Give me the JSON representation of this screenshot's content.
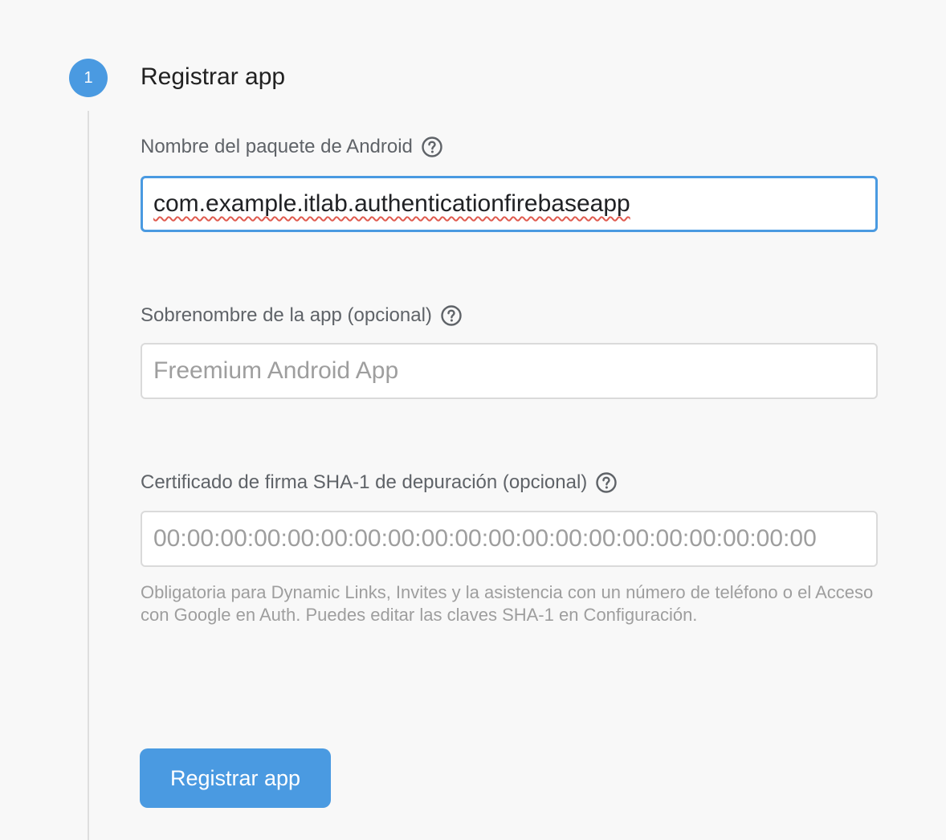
{
  "step": {
    "number": "1",
    "title": "Registrar app"
  },
  "package_field": {
    "label": "Nombre del paquete de Android",
    "value": "com.example.itlab.authenticationfirebaseapp",
    "help_icon": "help-circle-icon"
  },
  "nickname_field": {
    "label": "Sobrenombre de la app (opcional)",
    "placeholder": "Freemium Android App",
    "help_icon": "help-circle-icon"
  },
  "sha1_field": {
    "label": "Certificado de firma SHA-1 de depuración (opcional)",
    "placeholder": "00:00:00:00:00:00:00:00:00:00:00:00:00:00:00:00:00:00:00:00",
    "help_icon": "help-circle-icon",
    "hint": "Obligatoria para Dynamic Links, Invites y la asistencia con un número de teléfono o el Acceso con Google en Auth. Puedes editar las claves SHA-1 en Configuración."
  },
  "submit_button": {
    "label": "Registrar app"
  },
  "colors": {
    "accent": "#4a9ae1",
    "background": "#f8f8f8",
    "spellcheck_underline": "#e05a4e"
  }
}
